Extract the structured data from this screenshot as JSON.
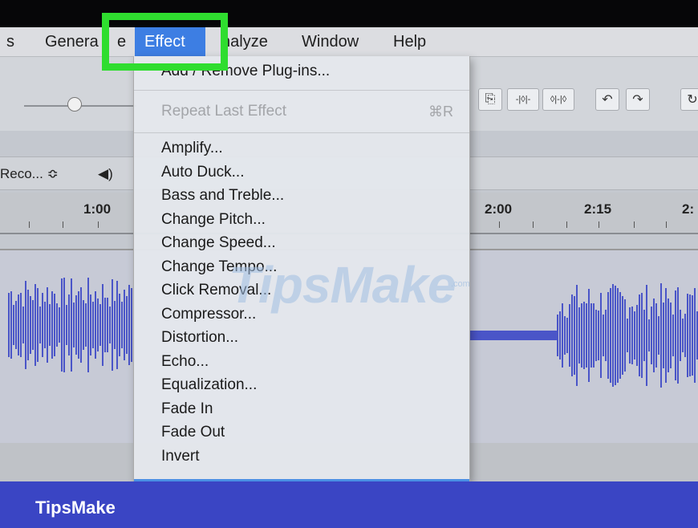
{
  "menubar": {
    "items_before": [
      "s",
      "Genera",
      "e"
    ],
    "effect": "Effect",
    "analyze_partial": "nalyze",
    "window": "Window",
    "help": "Help"
  },
  "toolbar": {
    "buttons": [
      "⎘",
      "-|◊|-",
      "◊|-|◊",
      "↶",
      "↷",
      "↻"
    ]
  },
  "device": {
    "recording_label": "Reco... ≎",
    "speaker": "◀)"
  },
  "ruler": {
    "labels": [
      "1:00",
      "2:00",
      "2:15",
      "2:"
    ]
  },
  "effect_menu": {
    "top_item": "Add / Remove Plug-ins...",
    "repeat": "Repeat Last Effect",
    "repeat_shortcut": "⌘R",
    "items": [
      "Amplify...",
      "Auto Duck...",
      "Bass and Treble...",
      "Change Pitch...",
      "Change Speed...",
      "Change Tempo...",
      "Click Removal...",
      "Compressor...",
      "Distortion...",
      "Echo...",
      "Equalization...",
      "Fade In",
      "Fade Out",
      "Invert"
    ]
  },
  "watermark": {
    "text": "TipsMake",
    "com": ".com"
  },
  "brand": "TipsMake",
  "colors": {
    "accent": "#3d7ee3",
    "highlight_box": "#2fdd2f",
    "brand_bar": "#3a45c4",
    "waveform": "#4a55c8"
  }
}
